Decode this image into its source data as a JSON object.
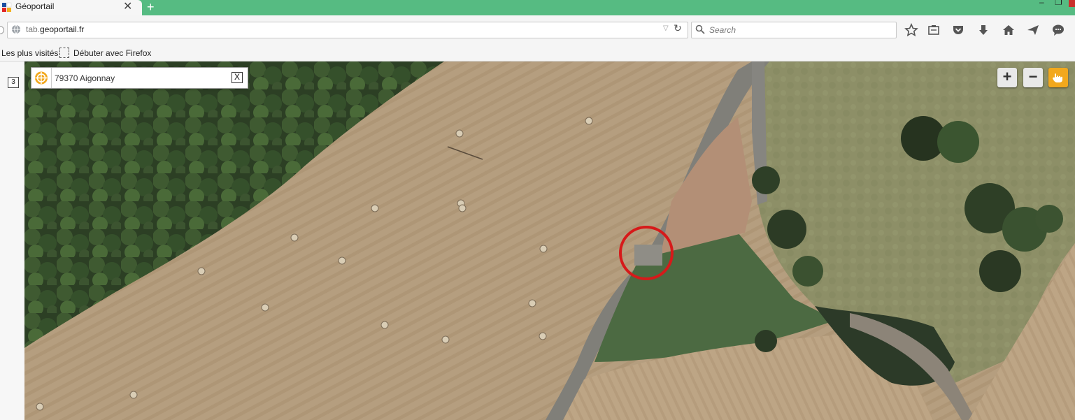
{
  "browser": {
    "tab_title": "Géoportail",
    "tab_close": "✕",
    "new_tab": "+",
    "url_prefix": "tab.",
    "url_domain": "geoportail.fr",
    "search_placeholder": "Search",
    "window_controls": [
      "–",
      "❐"
    ]
  },
  "bookmarks": {
    "most_visited": "Les plus visités",
    "getting_started": "Débuter avec Firefox"
  },
  "left_panel": {
    "layer_count": "3"
  },
  "map": {
    "search_value": "79370 Aigonnay",
    "clear_label": "X",
    "zoom_in": "+",
    "zoom_out": "−",
    "highlight_color": "#d61a1a"
  },
  "colors": {
    "tab_strip": "#56bb82",
    "map_button_accent": "#f2a81d"
  },
  "icons": [
    "globe-icon",
    "dropdown-icon",
    "reload-icon",
    "search-icon",
    "star-icon",
    "reading-list-icon",
    "pocket-icon",
    "download-icon",
    "home-icon",
    "send-icon",
    "chat-icon",
    "locate-icon",
    "pan-hand-icon"
  ]
}
